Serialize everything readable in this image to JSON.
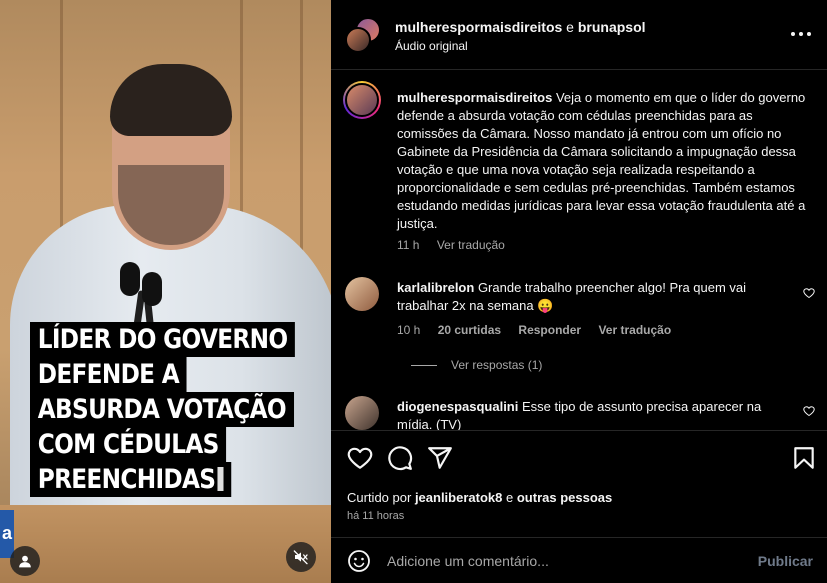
{
  "post_header": {
    "author_primary": "mulherespormaisdireitos",
    "conjunction": "e",
    "author_secondary": "brunapsol",
    "audio_label": "Áudio original"
  },
  "video": {
    "headline_lines": [
      "LÍDER DO GOVERNO",
      "DEFENDE A",
      "ABSURDA VOTAÇÃO",
      "COM CÉDULAS",
      "PREENCHIDAS"
    ],
    "logo_char": "a",
    "icons": {
      "profile": "person-icon",
      "mute": "muted-speaker-icon"
    }
  },
  "caption": {
    "username": "mulherespormaisdireitos",
    "text": "Veja o momento em que o líder do governo defende a absurda votação com cédulas preenchidas para as comissões da Câmara. Nosso mandato já entrou com um ofício no Gabinete da Presidência da Câmara solicitando a impugnação dessa votação e que uma nova votação seja realizada respeitando a proporcionalidade e sem cedulas pré-preenchidas. Também estamos estudando medidas jurídicas para levar essa votação fraudulenta até a justiça.",
    "time": "11 h",
    "translate": "Ver tradução"
  },
  "comments": [
    {
      "username": "karlalibrelon",
      "text": "Grande trabalho preencher algo! Pra quem vai trabalhar 2x na semana 😛",
      "time": "10 h",
      "likes": "20 curtidas",
      "reply": "Responder",
      "translate": "Ver tradução",
      "view_replies": "Ver respostas (1)"
    },
    {
      "username": "diogenespasqualini",
      "text": "Esse tipo de assunto precisa aparecer na mídia. (TV)"
    }
  ],
  "actions": {
    "icons": [
      "heart-icon",
      "comment-icon",
      "share-icon",
      "bookmark-icon"
    ],
    "liked_by_prefix": "Curtido por",
    "liked_by_user": "jeanliberatok8",
    "liked_by_and": "e",
    "liked_by_others": "outras pessoas",
    "time_ago": "há 11 horas"
  },
  "add_comment": {
    "placeholder": "Adicione um comentário...",
    "publish": "Publicar"
  },
  "colors": {
    "background": "#000000",
    "secondary_text": "#a8a8a8",
    "publish_disabled": "#6f7a8a",
    "story_ring": [
      "#f9ce34",
      "#ee2a7b",
      "#6228d7"
    ]
  }
}
